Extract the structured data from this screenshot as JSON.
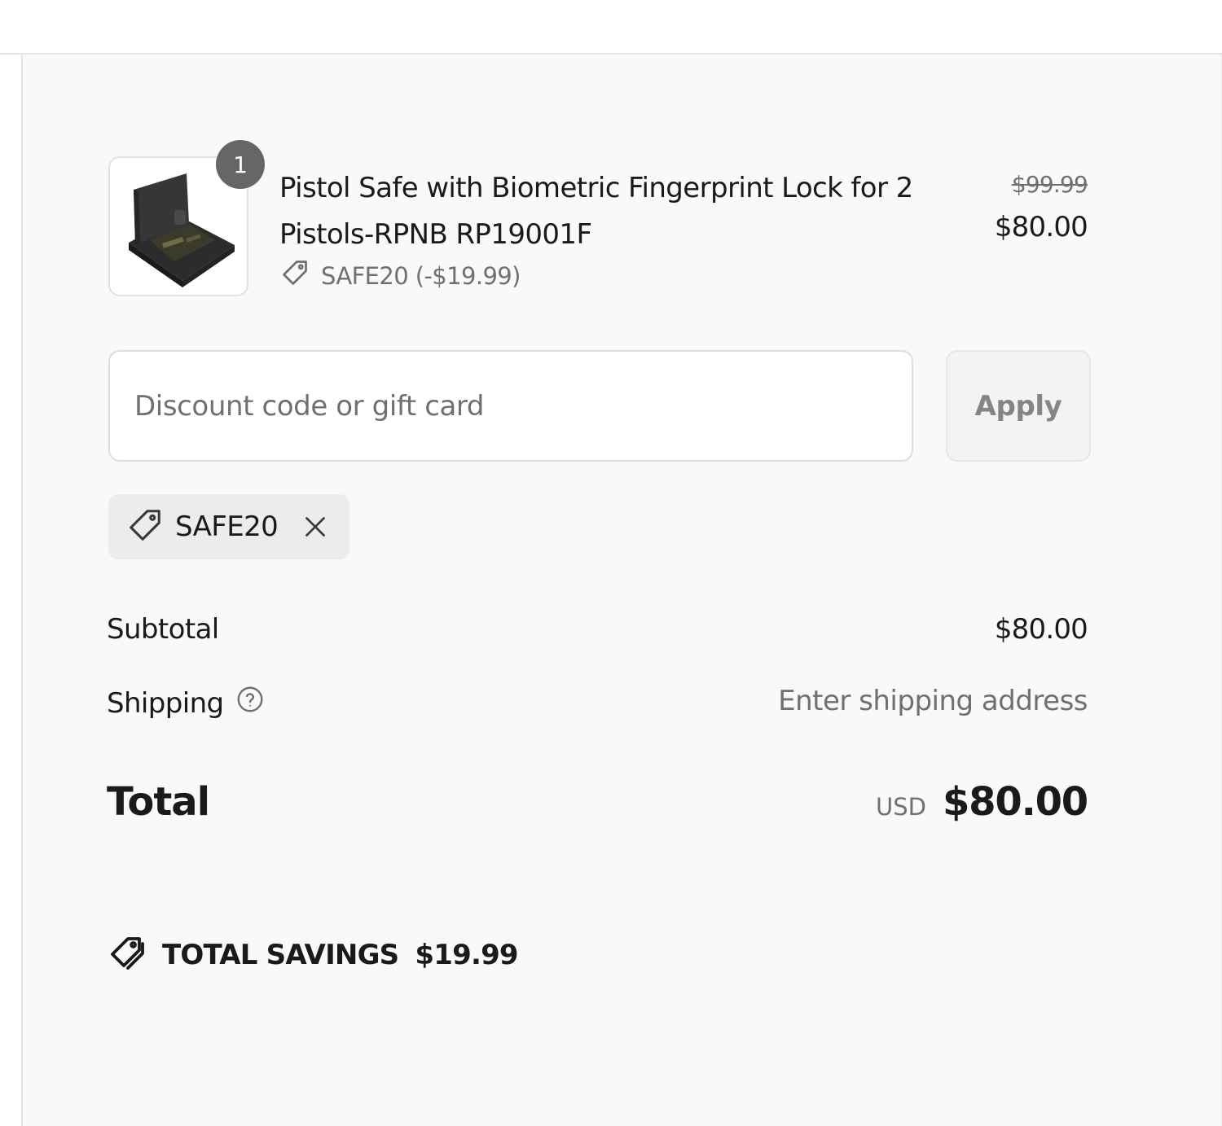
{
  "line_item": {
    "quantity": "1",
    "title": "Pistol Safe with Biometric Fingerprint Lock for 2 Pistols-RPNB RP19001F",
    "discount_text": "SAFE20 (-$19.99)",
    "original_price": "$99.99",
    "price": "$80.00"
  },
  "discount_form": {
    "placeholder": "Discount code or gift card",
    "value": "",
    "apply_label": "Apply"
  },
  "applied_code": {
    "label": "SAFE20"
  },
  "totals": {
    "subtotal_label": "Subtotal",
    "subtotal_value": "$80.00",
    "shipping_label": "Shipping",
    "shipping_value": "Enter shipping address",
    "total_label": "Total",
    "currency": "USD",
    "total_value": "$80.00"
  },
  "savings": {
    "label": "TOTAL SAVINGS",
    "amount": "$19.99"
  },
  "icons": [
    "tag-icon",
    "close-icon",
    "help-icon",
    "savings-tag-icon"
  ]
}
